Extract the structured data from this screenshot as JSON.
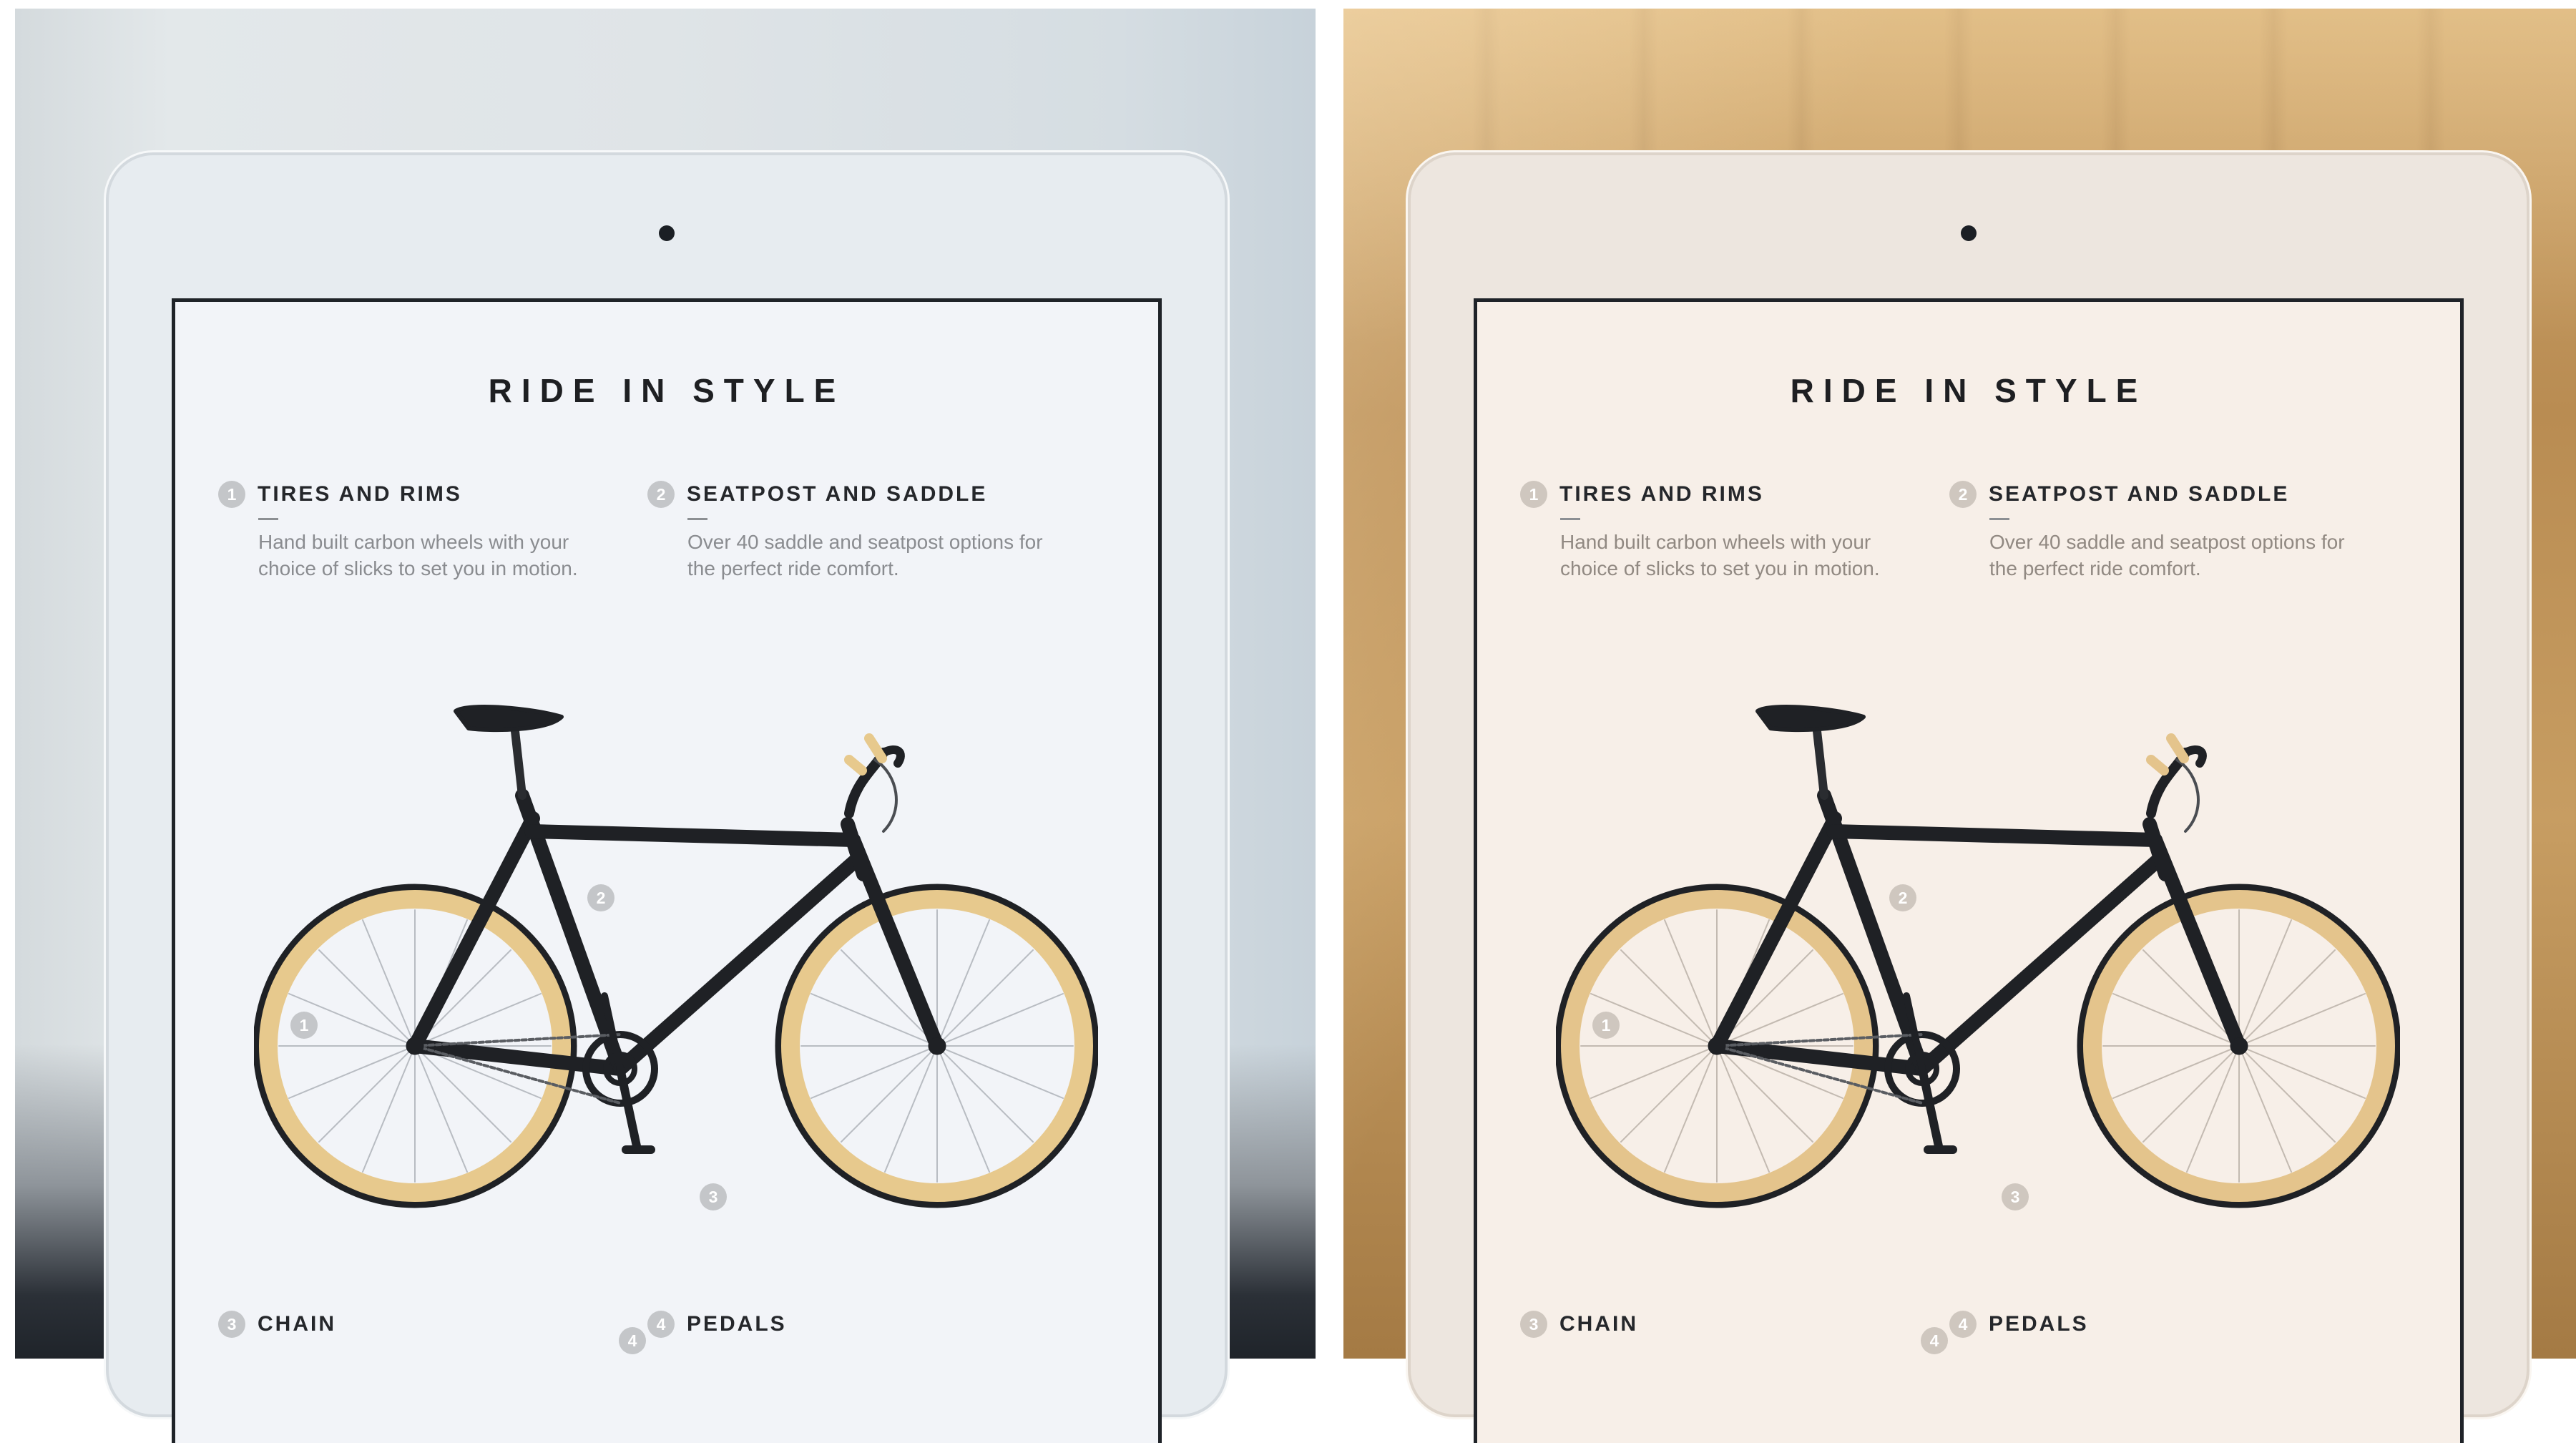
{
  "comparison": {
    "left": {
      "title": "RIDE IN STYLE",
      "features": [
        {
          "num": "1",
          "title": "TIRES AND RIMS",
          "desc": "Hand built carbon wheels with your choice of slicks to set you in motion."
        },
        {
          "num": "2",
          "title": "SEATPOST AND SADDLE",
          "desc": "Over 40 saddle and seatpost options for the perfect ride comfort."
        },
        {
          "num": "3",
          "title": "CHAIN",
          "desc": ""
        },
        {
          "num": "4",
          "title": "PEDALS",
          "desc": ""
        }
      ],
      "callouts": [
        "1",
        "2",
        "3",
        "4"
      ],
      "colors": {
        "screen": "#f2f4f8",
        "rim": "#e7c98d",
        "frame": "#1f2125"
      }
    },
    "right": {
      "title": "RIDE IN STYLE",
      "features": [
        {
          "num": "1",
          "title": "TIRES AND RIMS",
          "desc": "Hand built carbon wheels with your choice of slicks to set you in motion."
        },
        {
          "num": "2",
          "title": "SEATPOST AND SADDLE",
          "desc": "Over 40 saddle and seatpost options for the perfect ride comfort."
        },
        {
          "num": "3",
          "title": "CHAIN",
          "desc": ""
        },
        {
          "num": "4",
          "title": "PEDALS",
          "desc": ""
        }
      ],
      "callouts": [
        "1",
        "2",
        "3",
        "4"
      ],
      "colors": {
        "screen": "#f7efe8",
        "rim": "#e4c48c",
        "frame": "#1f2125"
      }
    }
  }
}
